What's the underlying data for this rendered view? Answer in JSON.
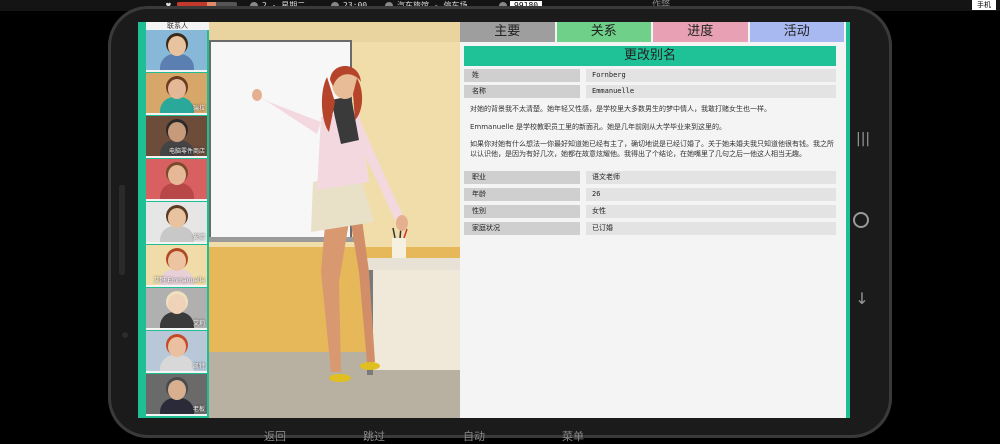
{
  "topbar": {
    "hp": {
      "red_fraction": 0.5,
      "pink_fraction": 0.15
    },
    "date": "2 - 星期二",
    "time": "23:00",
    "location": "汽车旅馆 - 停车场",
    "money": "99180",
    "cheat": "作弊",
    "menu": "手机"
  },
  "contacts": {
    "title": "联系人",
    "items": [
      {
        "name": "",
        "skin": "#e9c2a0",
        "hair": "#3b2a1a",
        "shirt": "#5a7fb0",
        "bg": "#88b8d8"
      },
      {
        "name": "瑞拉",
        "skin": "#e4b896",
        "hair": "#6b3b20",
        "shirt": "#2aa89a",
        "bg": "#d7a76a"
      },
      {
        "name": "电脑零件商店",
        "skin": "#c89a7c",
        "hair": "#2a2a2a",
        "shirt": "#444444",
        "bg": "#6d4d3a"
      },
      {
        "name": "",
        "skin": "#e6b898",
        "hair": "#7a4a2a",
        "shirt": "#b84848",
        "bg": "#d86060"
      },
      {
        "name": "安娜",
        "skin": "#e9c2a0",
        "hair": "#5a3a22",
        "shirt": "#c8c8c8",
        "bg": "#e6e6e6"
      },
      {
        "name": "艾玛 Emmanuelle",
        "skin": "#edc4a2",
        "hair": "#b04a22",
        "shirt": "#e8d0d8",
        "bg": "#f0dca8"
      },
      {
        "name": "艾莉",
        "skin": "#f0d2b8",
        "hair": "#f0e0c0",
        "shirt": "#3a3a3a",
        "bg": "#b0b0b0"
      },
      {
        "name": "凯特",
        "skin": "#eac0a0",
        "hair": "#c44a2a",
        "shirt": "#d8d8d8",
        "bg": "#b8c8d8"
      },
      {
        "name": "老板",
        "skin": "#d8b090",
        "hair": "#4a4a4a",
        "shirt": "#2a2a38",
        "bg": "#6a6a6a"
      }
    ]
  },
  "tabs": [
    {
      "label": "主要",
      "color": "#9e9e9e"
    },
    {
      "label": "关系",
      "color": "#6fd08a"
    },
    {
      "label": "进度",
      "color": "#e7a0b4"
    },
    {
      "label": "活动",
      "color": "#a8b8f0"
    }
  ],
  "profile": {
    "title": "更改别名",
    "surname_label": "姓",
    "surname": "Fornberg",
    "name_label": "名称",
    "name": "Emmanuelle",
    "desc1": "对她的背景我不太清楚。她年轻又性感，是学校里大多数男生的梦中情人，我敢打赌女生也一样。",
    "desc2": "Emmanuelle 是学校教职员工里的新面孔。她是几年前刚从大学毕业来到这里的。",
    "desc3": "如果你对她有什么想法一你最好知道她已经有主了，确切地说是已经订婚了。关于她未婚夫我只知道他很有钱。我之所以认识他，是因为有好几次，她都在故意炫耀他。我得出了个结论，在她嘴里了几句之后一他这人相当无趣。",
    "job_label": "职业",
    "job": "语文老师",
    "age_label": "年龄",
    "age": "26",
    "gender_label": "性别",
    "gender": "女性",
    "marital_label": "家庭状况",
    "marital": "已订婚"
  },
  "bottom_menu": [
    "返回",
    "跳过",
    "自动",
    "菜单"
  ]
}
